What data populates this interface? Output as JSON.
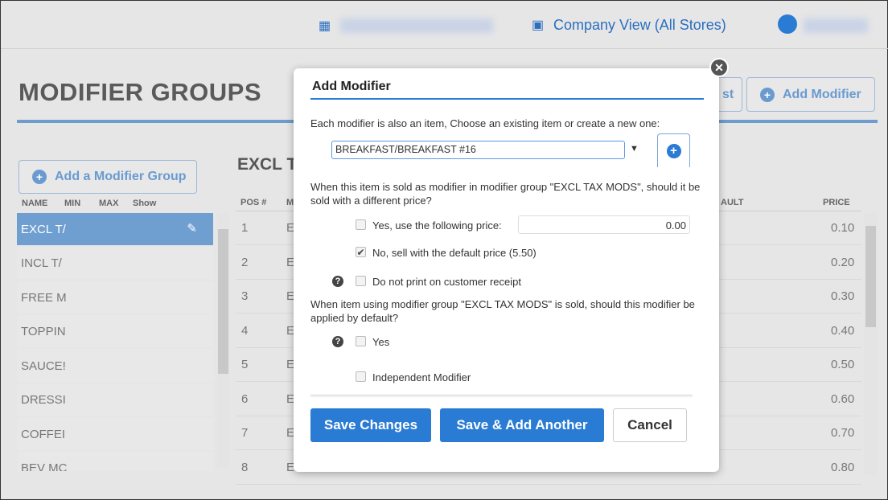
{
  "header": {
    "company_view": "Company View (All Stores)"
  },
  "page": {
    "title": "MODIFIER GROUPS",
    "add_modifier": "Add Modifier",
    "partial_button": "st",
    "group_title": "EXCL T"
  },
  "left": {
    "add_group": "Add a Modifier Group",
    "columns": [
      "NAME",
      "MIN",
      "MAX",
      "Show"
    ],
    "rows": [
      "EXCL T/",
      "INCL T/",
      "FREE M",
      "TOPPIN",
      "SAUCE!",
      "DRESSI",
      "COFFEI",
      "BEV MC"
    ]
  },
  "right": {
    "columns": [
      "POS #",
      "M",
      "AULT",
      "PRICE"
    ],
    "rows": [
      {
        "pos": "1",
        "m": "E",
        "price": "0.10"
      },
      {
        "pos": "2",
        "m": "E",
        "price": "0.20"
      },
      {
        "pos": "3",
        "m": "E",
        "price": "0.30"
      },
      {
        "pos": "4",
        "m": "E",
        "price": "0.40"
      },
      {
        "pos": "5",
        "m": "E",
        "price": "0.50"
      },
      {
        "pos": "6",
        "m": "E",
        "price": "0.60"
      },
      {
        "pos": "7",
        "m": "E",
        "price": "0.70"
      },
      {
        "pos": "8",
        "m": "E",
        "price": "0.80"
      }
    ]
  },
  "modal": {
    "title": "Add Modifier",
    "intro": "Each modifier is also an item, Choose an existing item or create a new one:",
    "item_value": "BREAKFAST/BREAKFAST #16",
    "q1": "When this item is sold as modifier in modifier group \"EXCL TAX MODS\", should it be sold with a different price?",
    "opt_yes_price": "Yes, use the following price:",
    "price_value": "0.00",
    "opt_no_price": "No, sell with the default price (5.50)",
    "no_print": "Do not print on customer receipt",
    "q2": "When item using modifier group \"EXCL TAX MODS\" is sold, should this modifier be applied by default?",
    "opt_yes": "Yes",
    "independent": "Independent Modifier",
    "save": "Save Changes",
    "save_add": "Save & Add Another",
    "cancel": "Cancel",
    "checked": {
      "yes_price": false,
      "no_price": true,
      "no_print": false,
      "yes": false,
      "independent": false
    }
  },
  "colors": {
    "accent": "#2a7bd4",
    "selected_row": "#6e9fd0"
  }
}
